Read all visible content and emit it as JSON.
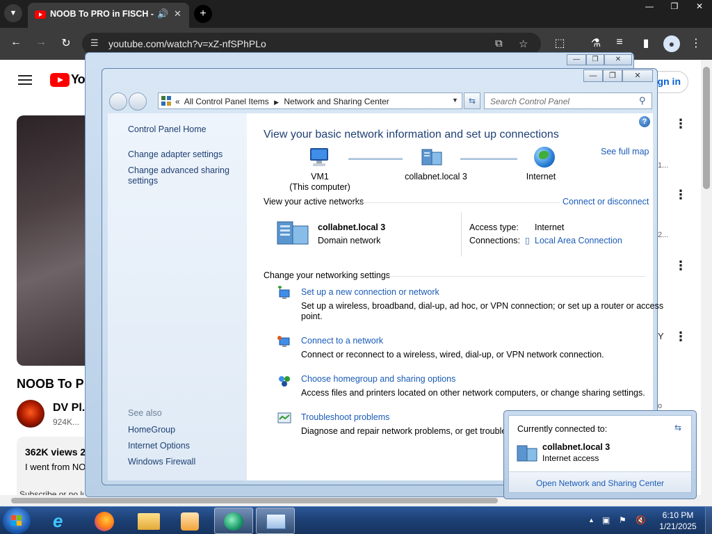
{
  "browser": {
    "tab_title": "NOOB To PRO in FISCH - $",
    "tab_sound_icon": "speaker-icon",
    "tab_close": "✕",
    "new_tab": "+",
    "url": "youtube.com/watch?v=xZ-nfSPhPLo",
    "window_controls": {
      "minimize": "—",
      "restore": "❐",
      "close": "✕"
    }
  },
  "youtube": {
    "logo_text": "Yo",
    "sign_in": "ign in",
    "video_title": "NOOB To P",
    "channel_name": "DV Pl...",
    "channel_subs": "924K...",
    "views": "362K views  2",
    "desc_line": "I went from NOO",
    "desc_line2": "Subscribe or no luck for u...  / @realdv...  ...more",
    "sidebar_fragments": [
      "1...",
      "2...",
      "Y",
      "o"
    ]
  },
  "control_panel": {
    "breadcrumb": [
      "All Control Panel Items",
      "Network and Sharing Center"
    ],
    "breadcrumb_prefix": "«",
    "search_placeholder": "Search Control Panel",
    "left_pane": {
      "home": "Control Panel Home",
      "links": [
        "Change adapter settings",
        "Change advanced sharing settings"
      ],
      "see_also": "See also",
      "see_also_links": [
        "HomeGroup",
        "Internet Options",
        "Windows Firewall"
      ]
    },
    "title": "View your basic network information and set up connections",
    "see_full_map": "See full map",
    "map": {
      "computer": "VM1",
      "computer_sub": "(This computer)",
      "network": "collabnet.local  3",
      "internet": "Internet"
    },
    "active_networks": {
      "heading": "View your active networks",
      "connect_disconnect": "Connect or disconnect",
      "name": "collabnet.local  3",
      "type": "Domain network",
      "access_type_label": "Access type:",
      "access_type_value": "Internet",
      "connections_label": "Connections:",
      "connections_value": "Local Area Connection"
    },
    "settings": {
      "heading": "Change your networking settings",
      "items": [
        {
          "title": "Set up a new connection or network",
          "desc": "Set up a wireless, broadband, dial-up, ad hoc, or VPN connection; or set up a router or access",
          "desc2": "point."
        },
        {
          "title": "Connect to a network",
          "desc": "Connect or reconnect to a wireless, wired, dial-up, or VPN network connection."
        },
        {
          "title": "Choose homegroup and sharing options",
          "desc": "Access files and printers located on other network computers, or change sharing settings."
        },
        {
          "title": "Troubleshoot problems",
          "desc": "Diagnose and repair network problems, or get troublesh"
        }
      ]
    },
    "window_controls": {
      "minimize": "—",
      "restore": "❐",
      "close": "✕"
    }
  },
  "flyout": {
    "heading": "Currently connected to:",
    "network": "collabnet.local  3",
    "access": "Internet access",
    "link": "Open Network and Sharing Center"
  },
  "taskbar": {
    "time": "6:10 PM",
    "date": "1/21/2025",
    "tray_arrow": "▲"
  }
}
